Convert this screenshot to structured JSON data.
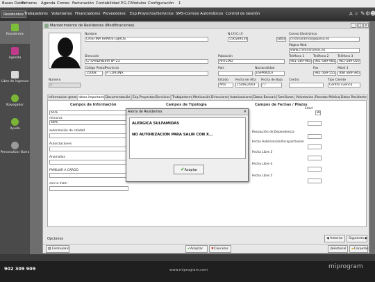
{
  "menubar": [
    "Bases Datos",
    "Ficheros",
    "Agenda",
    "Correo",
    "Facturación",
    "Contabilidad P.G.C.",
    "Módulos",
    "Configuración",
    "1"
  ],
  "toolbar": {
    "tabs": [
      "Residentes",
      "Trabajadores",
      "Voluntarios",
      "Financiadores",
      "Proveedores",
      "Exp.Proyectos/Servicios",
      "SMS-Correos Automáticos",
      "Control de Gestión"
    ],
    "right_icons": [
      "A",
      "search-icon",
      "pen-icon",
      "gear-icon",
      "user-icon"
    ]
  },
  "sidebar": [
    {
      "label": "Residentes",
      "icon": "user-icon",
      "color": "#7bbf3a"
    },
    {
      "label": "Agenda",
      "icon": "agenda-icon",
      "color": "#c03b8c"
    },
    {
      "label": "Libro de ingresos",
      "icon": "book-icon",
      "color": "#d9d9d9"
    },
    {
      "label": "Navegador",
      "icon": "navigator-icon",
      "color": "#7ab535"
    },
    {
      "label": "Ayuda",
      "icon": "help-icon",
      "color": "#7ab535"
    },
    {
      "label": "Personalizar Barra",
      "icon": "settings-icon",
      "color": "#9a9a9a"
    }
  ],
  "window": {
    "title": "Mantenimiento de Residentes (Modificaciones)"
  },
  "form": {
    "nombre_label": "Nombre",
    "nombre": "CRISTINA RAMOS GIJROS",
    "nif_label": "N.I.F./C.I.F.",
    "nif": "55658955K",
    "letra_btn": "Letra",
    "email_label": "Correo Electrónico",
    "email": "cristinaramos@queso.es",
    "web_label": "Página Web",
    "web": "www.cristinaramos.es",
    "direccion_label": "Dirección",
    "direccion": "C/ SARDIÑEIRA Nº 23",
    "poblacion_label": "Población",
    "poblacion": "ARTEIXO",
    "tel1_label": "Teléfono 1",
    "tel1": "981-589-985",
    "tel2_label": "Teléfono 2",
    "tel2": "981-589-985",
    "tel3_label": "Teléfono 3",
    "tel3": "981-589-000",
    "cp_label": "Código Postal",
    "cp": "15008",
    "provincia_label": "Provincia",
    "provincia": "A CORUÑA",
    "pais_label": "País",
    "pais": "",
    "nacionalidad_label": "Nacionalidad",
    "nacionalidad": "ESPAÑOLA",
    "fax_label": "Fax",
    "fax": "981-569-555",
    "movil_label": "Móvil 1",
    "movil": "(68) 889 985",
    "numero_label": "Número",
    "numero": "1",
    "estado_label": "Estado",
    "estado": "Alta",
    "fecha_alta_label": "Fecha de Alta",
    "fecha_alta": "15/06/2003",
    "fecha_baja_label": "Fecha de Baja",
    "fecha_baja": "/ /",
    "centro_label": "Centro",
    "centro": "",
    "tipo_label": "Tipo Cliente",
    "tipo": "Centro cuenca"
  },
  "tabs": [
    "Informacion general",
    "datos importantes",
    "Documentación",
    "Exp.Proyectos/Servicios",
    "Trabajadores",
    "Medicación",
    "Direcciones",
    "Autorizaciones",
    "Datos Bancarios",
    "Familiares",
    "Voluntarios",
    "Recetas Médicas",
    "Datos Residente"
  ],
  "panel": {
    "sec1": "Campos de Información",
    "sec2": "Campos de Tipología",
    "sec3": "Campos de Fechas / Plazos",
    "f1": "65%",
    "f2_label": "minusva",
    "f2": "48%",
    "f3_label": "autorización de calidad",
    "f4_label": "Autorizaciones",
    "f5_label": "Anomalías",
    "f6_label": "FAMILIAR A CARGO",
    "f7_label": "con la mam",
    "edad_label": "Edad",
    "edad": "89",
    "r1_label": "Resolución de Dependencia",
    "r2_label": "Fecha Autorización/Incapacitación",
    "r3_label": "Fecha Libre 3",
    "r4_label": "Fecha Libre 4",
    "r5_label": "Fecha Libre 5"
  },
  "bottom": {
    "opciones": "Opciones",
    "anterior": "Anterior",
    "siguiente": "Siguiente",
    "formulario": "Formulario",
    "aceptar": "Aceptar",
    "cancelar": "Cancelar",
    "historial": "Historial",
    "carpetas": "Carpetas"
  },
  "dialog": {
    "title": "Alerta de Residentes",
    "line1": "ALERGICA SULFAMIDAS",
    "line2": "NO AUTORIZACION PARA SALIR CON X...",
    "button": "Aceptar"
  },
  "footer": {
    "phone": "902 309 909",
    "url": "www.miprogram.com",
    "logo": "miprogram"
  }
}
